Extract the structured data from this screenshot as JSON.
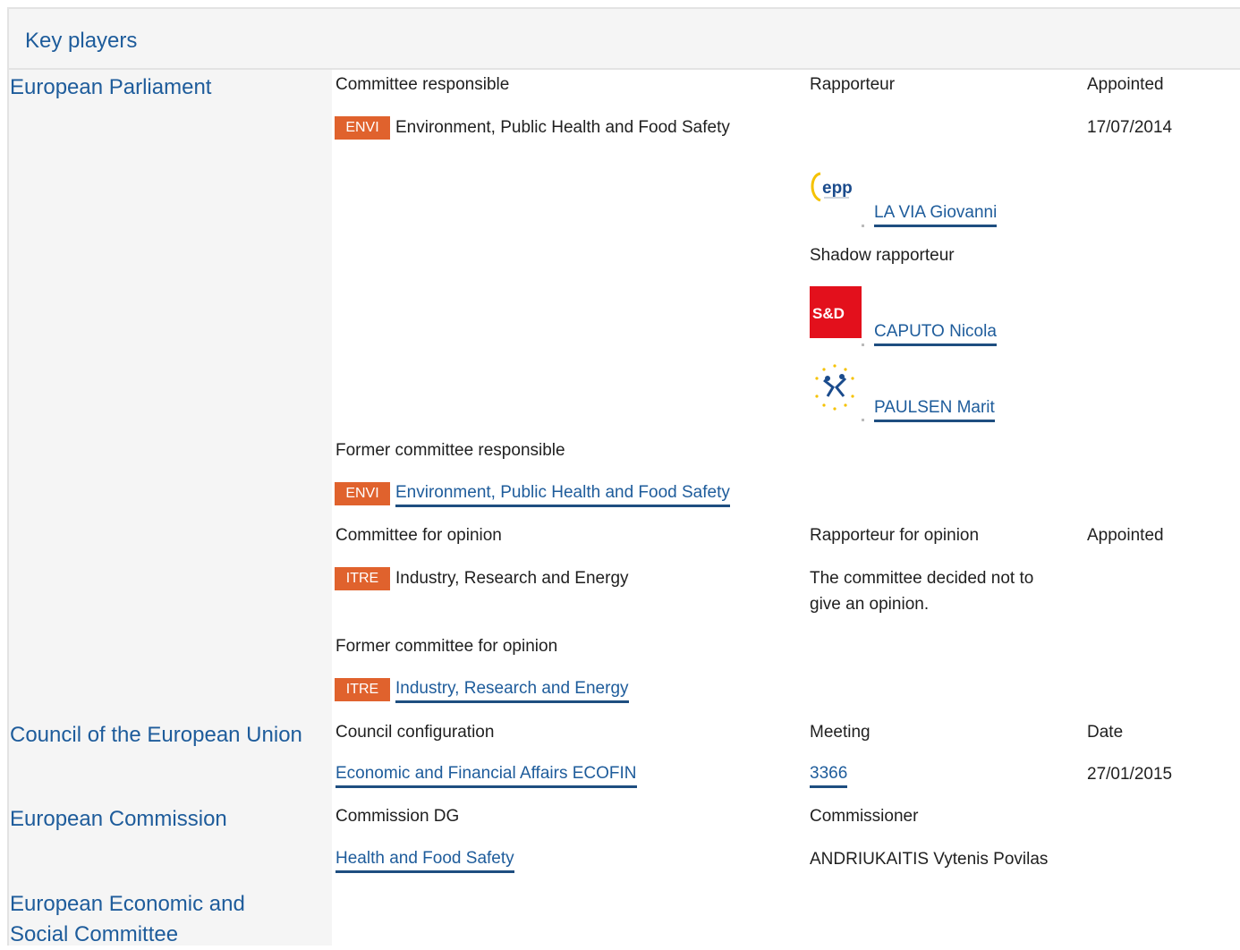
{
  "header": {
    "title": "Key players"
  },
  "sidebar": {
    "parliament": "European Parliament",
    "council": "Council of the European Union",
    "commission": "European Commission",
    "eesc_line1": "European Economic and",
    "eesc_line2": "Social Committee"
  },
  "parliament": {
    "col_committee": "Committee responsible",
    "col_rapporteur": "Rapporteur",
    "col_appointed": "Appointed",
    "committee_badge": "ENVI",
    "committee_name": "Environment, Public Health and Food Safety",
    "appointed_date": "17/07/2014",
    "rapporteur": {
      "group_logo": "epp-logo",
      "logo_text": "epp",
      "name": "LA VIA Giovanni"
    },
    "shadow_label": "Shadow rapporteur",
    "shadows": [
      {
        "group_logo": "sd-logo",
        "logo_text": "S&D",
        "name": "CAPUTO Nicola"
      },
      {
        "group_logo": "efdd-logo",
        "name": "PAULSEN Marit"
      }
    ],
    "former_committee_label": "Former committee responsible",
    "former_committee_badge": "ENVI",
    "former_committee_name": "Environment, Public Health and Food Safety",
    "col_opinion": "Committee for opinion",
    "col_opinion_rapporteur": "Rapporteur for opinion",
    "col_opinion_appointed": "Appointed",
    "opinion_badge": "ITRE",
    "opinion_name": "Industry, Research and Energy",
    "opinion_note_line1": "The committee decided not to",
    "opinion_note_line2": "give an opinion.",
    "former_opinion_label": "Former committee for opinion",
    "former_opinion_badge": "ITRE",
    "former_opinion_name": "Industry, Research and Energy"
  },
  "council": {
    "col_configuration": "Council configuration",
    "col_meeting": "Meeting",
    "col_date": "Date",
    "configuration": "Economic and Financial Affairs ECOFIN",
    "meeting": "3366",
    "date": "27/01/2015"
  },
  "commission": {
    "col_dg": "Commission DG",
    "col_commissioner": "Commissioner",
    "dg": "Health and Food Safety",
    "commissioner": "ANDRIUKAITIS Vytenis Povilas"
  },
  "colors": {
    "link": "#1e5c9b",
    "badge": "#e0622d",
    "panel": "#f5f5f5"
  }
}
